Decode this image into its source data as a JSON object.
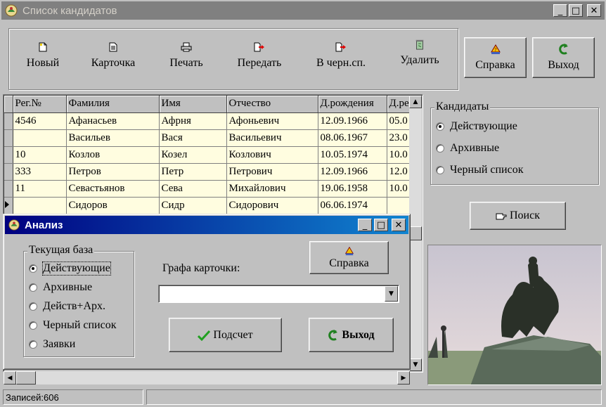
{
  "window": {
    "title": "Список кандидатов",
    "buttons": [
      "_",
      "□",
      "✕"
    ]
  },
  "toolbar": {
    "new": "Новый",
    "card": "Карточка",
    "print": "Печать",
    "transfer": "Передать",
    "blacklist": "В черн.сп.",
    "delete": "Удалить",
    "help": "Справка",
    "exit": "Выход"
  },
  "grid": {
    "columns": [
      "Рег.№",
      "Фамилия",
      "Имя",
      "Отчество",
      "Д.рождения",
      "Д.ре"
    ],
    "rows": [
      [
        "4546",
        "Афанасьев",
        "Афрня",
        "Афоньевич",
        "12.09.1966",
        "05.0"
      ],
      [
        "",
        "Васильев",
        "Вася",
        "Васильевич",
        "08.06.1967",
        "23.0"
      ],
      [
        "10",
        "Козлов",
        "Козел",
        "Козлович",
        "10.05.1974",
        "10.0"
      ],
      [
        "333",
        "Петров",
        "Петр",
        "Петрович",
        "12.09.1966",
        "12.0"
      ],
      [
        "11",
        "Севастьянов",
        "Сева",
        "Михайлович",
        "19.06.1958",
        "10.0"
      ],
      [
        "",
        "Сидоров",
        "Сидр",
        "Сидорович",
        "06.06.1974",
        ""
      ]
    ],
    "current_row": 5
  },
  "candidates": {
    "title": "Кандидаты",
    "options": [
      "Действующие",
      "Архивные",
      "Черный список"
    ],
    "selected": 0
  },
  "search_button": "Поиск",
  "dialog": {
    "title": "Анализ",
    "group_title": "Текущая база",
    "options": [
      "Действующие",
      "Архивные",
      "Действ+Арх.",
      "Черный список",
      "Заявки"
    ],
    "selected": 0,
    "field_label": "Графа карточки:",
    "field_value": "",
    "help": "Справка",
    "count": "Подсчет",
    "exit": "Выход"
  },
  "status": {
    "records": "Записей:606"
  },
  "colors": {
    "grid_bg": "#fffde0",
    "dialog_title_from": "#000080",
    "dialog_title_to": "#1084d0",
    "face": "#c0c0c0"
  }
}
